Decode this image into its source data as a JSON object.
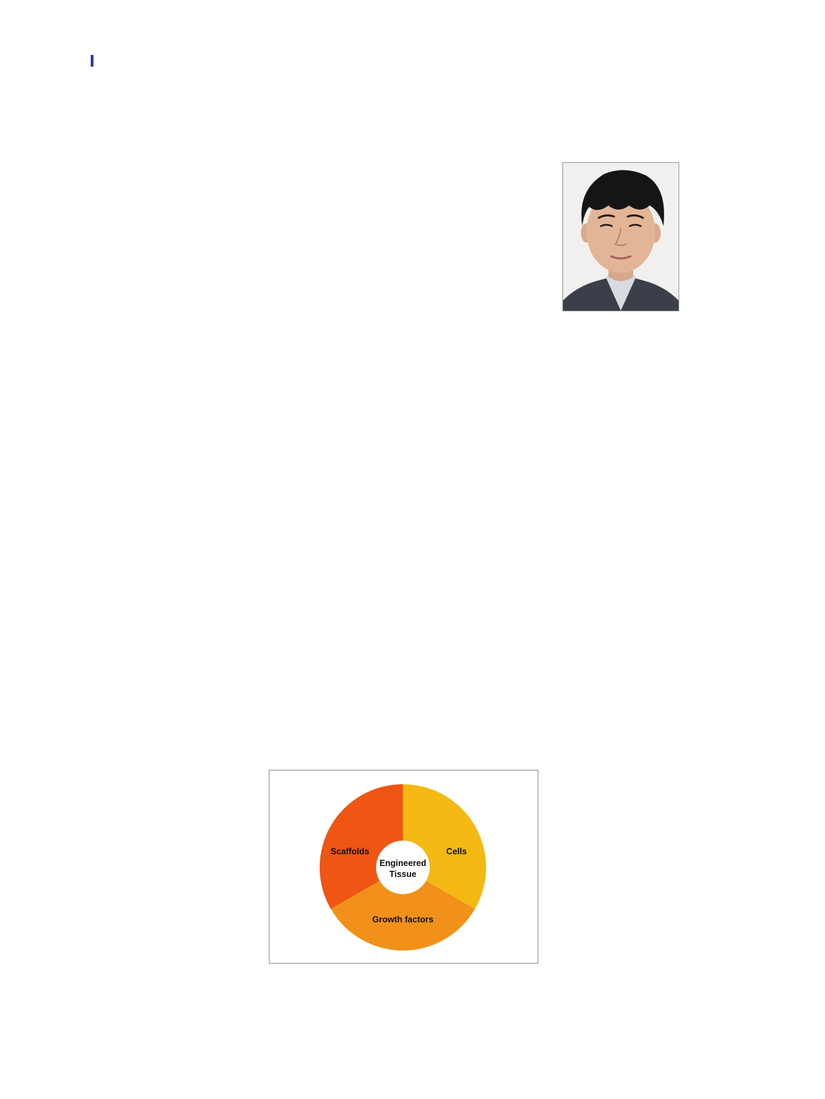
{
  "page": {
    "marker_color": "#2b3f94"
  },
  "portrait": {
    "icon": "person-portrait-photo",
    "background_color": "#f1f0ee"
  },
  "figure": {
    "center_label_line1": "Engineered",
    "center_label_line2": "Tissue",
    "segments": [
      {
        "label": "Cells",
        "color": "#f4b912"
      },
      {
        "label": "Growth factors",
        "color": "#f29119"
      },
      {
        "label": "Scaffolds",
        "color": "#ef5513"
      }
    ]
  }
}
